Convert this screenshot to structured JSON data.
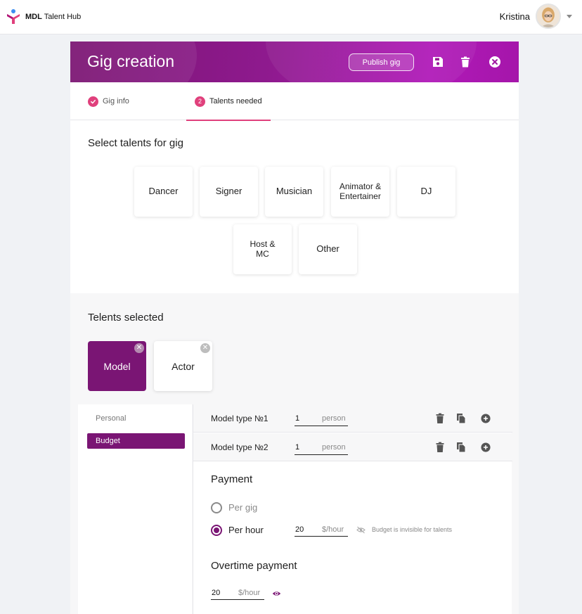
{
  "app": {
    "logo_bold": "MDL",
    "logo_rest": "Talent Hub"
  },
  "user": {
    "name": "Kristina"
  },
  "header": {
    "title": "Gig creation",
    "publish_label": "Publish gig",
    "icons": [
      "save-icon",
      "trash-icon",
      "close-icon"
    ]
  },
  "tabs": [
    {
      "label": "Gig info",
      "state": "done"
    },
    {
      "label": "Talents needed",
      "number": "2",
      "state": "active"
    }
  ],
  "talents": {
    "title": "Select talents for gig",
    "options": [
      "Dancer",
      "Signer",
      "Musician",
      "Animator & Entertainer",
      "DJ",
      "Host & MC",
      "Other"
    ]
  },
  "selected": {
    "title": "Telents selected",
    "items": [
      {
        "label": "Model",
        "active": true
      },
      {
        "label": "Actor",
        "active": false
      }
    ]
  },
  "side": {
    "items": [
      "Personal",
      "Budget"
    ]
  },
  "rows": [
    {
      "label": "Model type №1",
      "count": "1",
      "unit": "person"
    },
    {
      "label": "Model type №2",
      "count": "1",
      "unit": "person"
    }
  ],
  "payment": {
    "title": "Payment",
    "options": [
      "Per gig",
      "Per hour"
    ],
    "selected": "Per hour",
    "value": "20",
    "unit": "$/hour",
    "hint": "Budget is invisible for talents"
  },
  "overtime": {
    "title": "Overtime payment",
    "value": "20",
    "unit": "$/hour"
  },
  "colors": {
    "brand": "#7a1574",
    "accent": "#e0407c"
  }
}
